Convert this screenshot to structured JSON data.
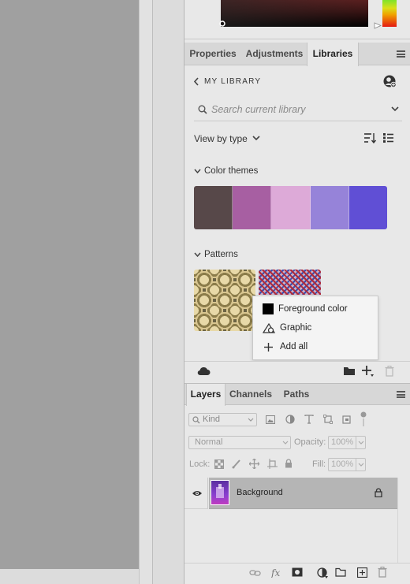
{
  "tabs_top": [
    {
      "label": "Properties"
    },
    {
      "label": "Adjustments"
    },
    {
      "label": "Libraries",
      "active": true
    }
  ],
  "library": {
    "back_label": "MY LIBRARY",
    "search_placeholder": "Search current library",
    "view_by": "View by type",
    "color_themes_label": "Color themes",
    "color_theme_swatches": [
      "#574849",
      "#a75fa2",
      "#ddaad8",
      "#9683d9",
      "#604fd5"
    ],
    "patterns_label": "Patterns"
  },
  "add_menu": {
    "items": [
      {
        "label": "Foreground color",
        "icon": "foreground-color-swatch-icon"
      },
      {
        "label": "Graphic",
        "icon": "graphic-icon"
      },
      {
        "label": "Add all",
        "icon": "plus-icon"
      }
    ]
  },
  "tabs_layers": [
    {
      "label": "Layers",
      "active": true
    },
    {
      "label": "Channels"
    },
    {
      "label": "Paths"
    }
  ],
  "layers": {
    "kind_label": "Kind",
    "blend_mode": "Normal",
    "opacity_label": "Opacity:",
    "opacity_value": "100%",
    "lock_label": "Lock:",
    "fill_label": "Fill:",
    "fill_value": "100%",
    "items": [
      {
        "name": "Background",
        "visible": true,
        "locked": true
      }
    ]
  }
}
